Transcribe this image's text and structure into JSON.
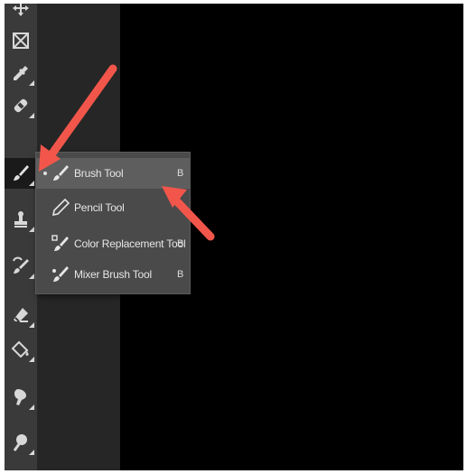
{
  "toolbar": {
    "tools": [
      {
        "icon": "move-icon"
      },
      {
        "icon": "frame-icon"
      },
      {
        "icon": "eyedropper-icon"
      },
      {
        "icon": "spot-healing-icon"
      },
      {
        "icon": "brush-icon",
        "active": true
      },
      {
        "icon": "clone-stamp-icon"
      },
      {
        "icon": "history-brush-icon"
      },
      {
        "icon": "eraser-icon"
      },
      {
        "icon": "paint-bucket-icon"
      },
      {
        "icon": "smudge-icon"
      },
      {
        "icon": "dodge-icon"
      }
    ]
  },
  "flyout": {
    "items": [
      {
        "label": "Brush Tool",
        "shortcut": "B",
        "icon": "brush-icon",
        "selected": true
      },
      {
        "label": "Pencil Tool",
        "shortcut": "",
        "icon": "pencil-icon",
        "selected": false
      },
      {
        "label": "Color Replacement Tool",
        "shortcut": "B",
        "icon": "color-replacement-icon",
        "selected": false
      },
      {
        "label": "Mixer Brush Tool",
        "shortcut": "B",
        "icon": "mixer-brush-icon",
        "selected": false
      }
    ]
  },
  "colors": {
    "annotation_arrow": "#f2564b",
    "toolbar_bg": "#3a3a3a",
    "flyout_bg": "#4a4a4a"
  }
}
